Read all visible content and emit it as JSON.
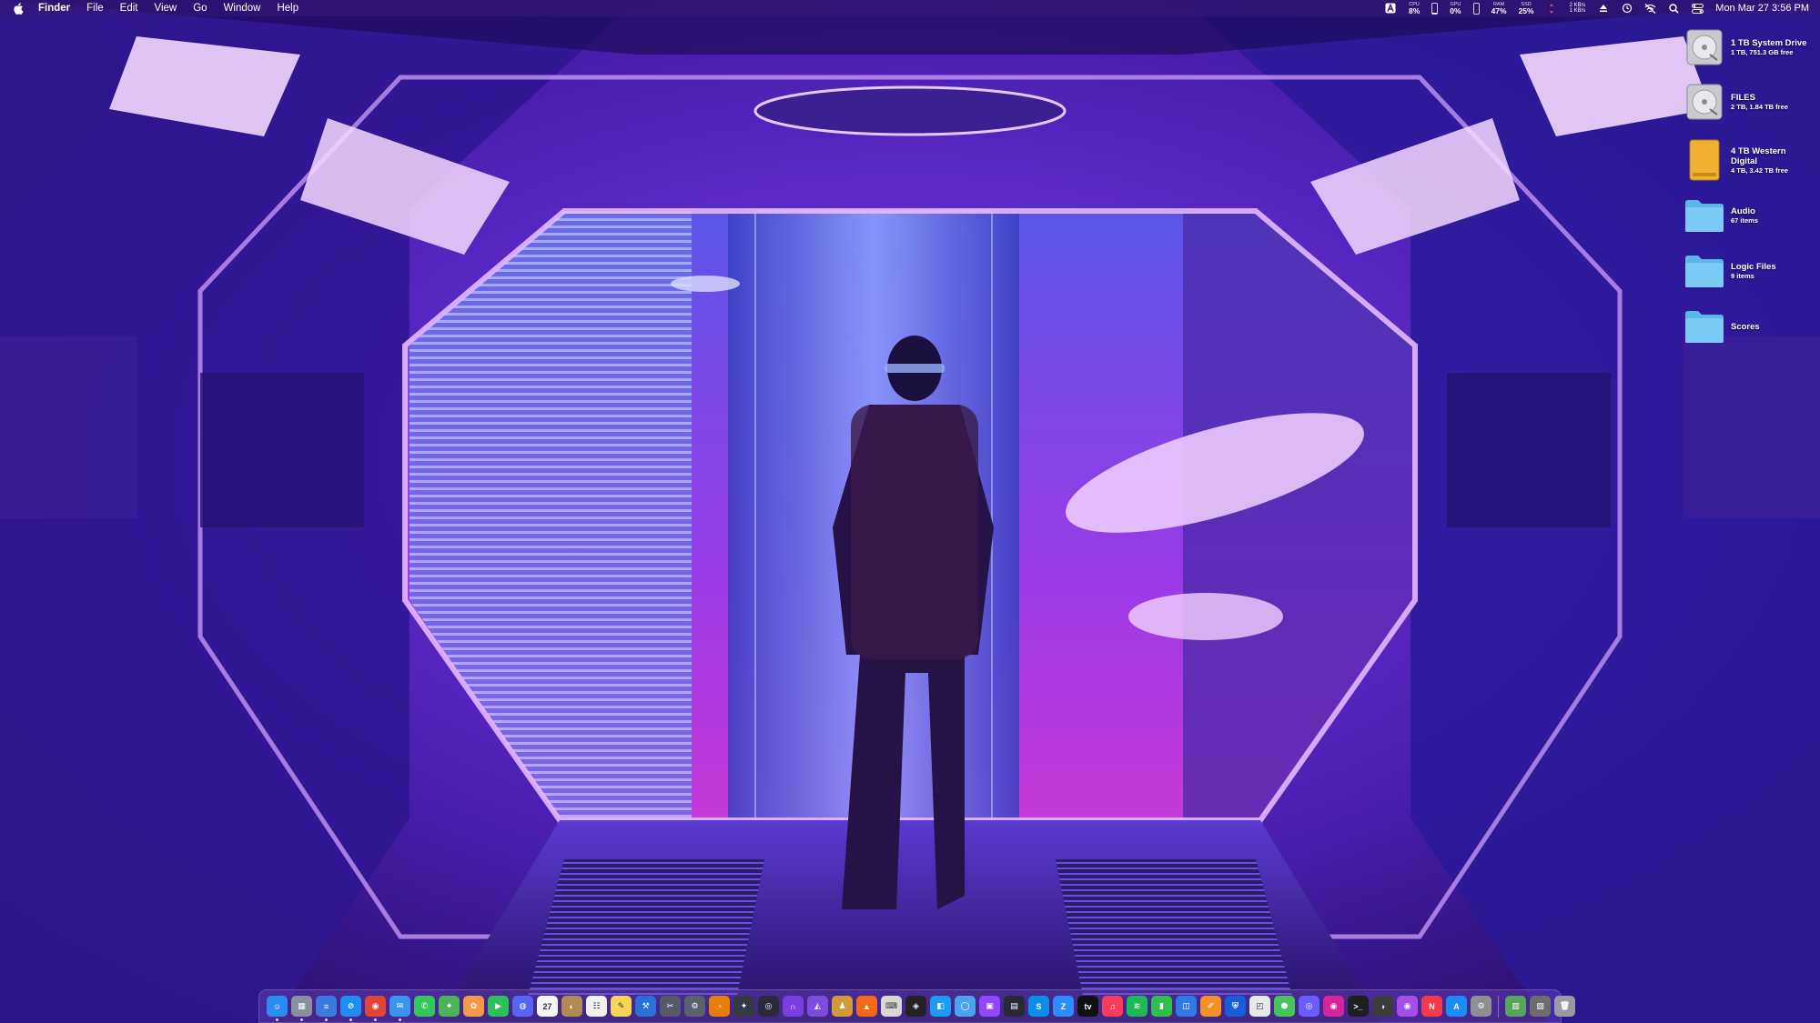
{
  "menubar": {
    "app_name": "Finder",
    "menus": [
      "File",
      "Edit",
      "View",
      "Go",
      "Window",
      "Help"
    ],
    "cpu": {
      "label": "CPU",
      "value": "8%"
    },
    "gpu": {
      "label": "GPU",
      "value": "0%"
    },
    "ram": {
      "label": "RAM",
      "value": "47%"
    },
    "ssd": {
      "label": "SSD",
      "value": "25%"
    },
    "cpu_bar": 8,
    "gpu_bar": 0,
    "network": {
      "up": "2 KB/s",
      "down": "1 KB/s"
    },
    "clock": "Mon Mar 27  3:56 PM"
  },
  "desktop_icons": [
    {
      "name": "1 TB System Drive",
      "info": "1 TB, 751.3 GB free",
      "icon": "hard-drive-icon"
    },
    {
      "name": "FILES",
      "info": "2 TB, 1.84 TB free",
      "icon": "hard-drive-icon"
    },
    {
      "name": "4 TB Western Digital",
      "info": "4 TB, 3.42 TB free",
      "icon": "external-drive-icon"
    },
    {
      "name": "Audio",
      "info": "67 items",
      "icon": "folder-icon"
    },
    {
      "name": "Logic Files",
      "info": "9 items",
      "icon": "folder-icon"
    },
    {
      "name": "Scores",
      "info": "",
      "icon": "folder-icon"
    }
  ],
  "dock": {
    "apps": [
      {
        "name": "finder",
        "color": "#2b8cf0",
        "glyph": "☺"
      },
      {
        "name": "launchpad",
        "color": "#8a8fa0",
        "glyph": "▦"
      },
      {
        "name": "files",
        "color": "#3b7be0",
        "glyph": "≡"
      },
      {
        "name": "safari",
        "color": "#1f8ef1",
        "glyph": "⊘"
      },
      {
        "name": "chrome",
        "color": "#e0443a",
        "glyph": "◉"
      },
      {
        "name": "mail",
        "color": "#3a94f0",
        "glyph": "✉"
      },
      {
        "name": "messages",
        "color": "#34c759",
        "glyph": "✆"
      },
      {
        "name": "maps",
        "color": "#4bb35a",
        "glyph": "⌖"
      },
      {
        "name": "photos",
        "color": "#f2994a",
        "glyph": "✿"
      },
      {
        "name": "facetime",
        "color": "#2fbf5a",
        "glyph": "▶"
      },
      {
        "name": "discord",
        "color": "#5865f2",
        "glyph": "◍"
      },
      {
        "name": "calendar",
        "color": "#f5f5f5",
        "glyph": "27"
      },
      {
        "name": "contacts",
        "color": "#b08a55",
        "glyph": "◐"
      },
      {
        "name": "reminders",
        "color": "#f0f0f0",
        "glyph": "☷"
      },
      {
        "name": "notes",
        "color": "#f7d35a",
        "glyph": "✎"
      },
      {
        "name": "xcode",
        "color": "#2a70d8",
        "glyph": "⚒"
      },
      {
        "name": "instruments",
        "color": "#555a66",
        "glyph": "✂"
      },
      {
        "name": "steam",
        "color": "#5a6270",
        "glyph": "⚙"
      },
      {
        "name": "blender",
        "color": "#e87d0d",
        "glyph": "◔"
      },
      {
        "name": "tool",
        "color": "#333a44",
        "glyph": "✦"
      },
      {
        "name": "obs",
        "color": "#2b2b3a",
        "glyph": "◎"
      },
      {
        "name": "arc",
        "color": "#7a3fe0",
        "glyph": "∩"
      },
      {
        "name": "affinity",
        "color": "#7d4cdb",
        "glyph": "◭"
      },
      {
        "name": "character",
        "color": "#d19a3a",
        "glyph": "♟"
      },
      {
        "name": "brave",
        "color": "#f06a1a",
        "glyph": "▲"
      },
      {
        "name": "keyboard",
        "color": "#d8d8d8",
        "glyph": "⌨"
      },
      {
        "name": "activity",
        "color": "#222",
        "glyph": "◈"
      },
      {
        "name": "app-store-connect",
        "color": "#1d9bf0",
        "glyph": "◧"
      },
      {
        "name": "quicktime",
        "color": "#4aa3f0",
        "glyph": "◯"
      },
      {
        "name": "twitch",
        "color": "#9146ff",
        "glyph": "▣"
      },
      {
        "name": "terminal-pro",
        "color": "#2a2a35",
        "glyph": "▤"
      },
      {
        "name": "skype",
        "color": "#0a8ee8",
        "glyph": "S"
      },
      {
        "name": "zoom",
        "color": "#2d8cff",
        "glyph": "Z"
      },
      {
        "name": "apple-tv",
        "color": "#111",
        "glyph": "tv"
      },
      {
        "name": "music",
        "color": "#fa3c5a",
        "glyph": "♫"
      },
      {
        "name": "spotify",
        "color": "#1db954",
        "glyph": "≋"
      },
      {
        "name": "numbers",
        "color": "#2fbf4a",
        "glyph": "▮"
      },
      {
        "name": "keynote",
        "color": "#2f7ae5",
        "glyph": "◫"
      },
      {
        "name": "pages",
        "color": "#f58f2a",
        "glyph": "✐"
      },
      {
        "name": "bitwarden",
        "color": "#175ddc",
        "glyph": "⛨"
      },
      {
        "name": "preview",
        "color": "#e8e8e8",
        "glyph": "◰"
      },
      {
        "name": "cube",
        "color": "#45c45a",
        "glyph": "⬢"
      },
      {
        "name": "portal",
        "color": "#6a5cff",
        "glyph": "◎"
      },
      {
        "name": "instagram",
        "color": "#d6249f",
        "glyph": "◉"
      },
      {
        "name": "terminal",
        "color": "#1e1e1e",
        "glyph": ">_"
      },
      {
        "name": "logic",
        "color": "#3c3c3c",
        "glyph": "◑"
      },
      {
        "name": "podcasts",
        "color": "#a54ee8",
        "glyph": "◉"
      },
      {
        "name": "news",
        "color": "#f23a4a",
        "glyph": "N"
      },
      {
        "name": "app-store",
        "color": "#1a8cf5",
        "glyph": "A"
      },
      {
        "name": "settings",
        "color": "#8e8e93",
        "glyph": "⚙"
      }
    ],
    "right_apps": [
      {
        "name": "downloads-stack",
        "color": "#5aa35a",
        "glyph": "▥"
      },
      {
        "name": "recent-stack",
        "color": "#6d6d6d",
        "glyph": "▧"
      },
      {
        "name": "trash",
        "color": "#9a9aa5",
        "glyph": "🗑"
      }
    ]
  }
}
